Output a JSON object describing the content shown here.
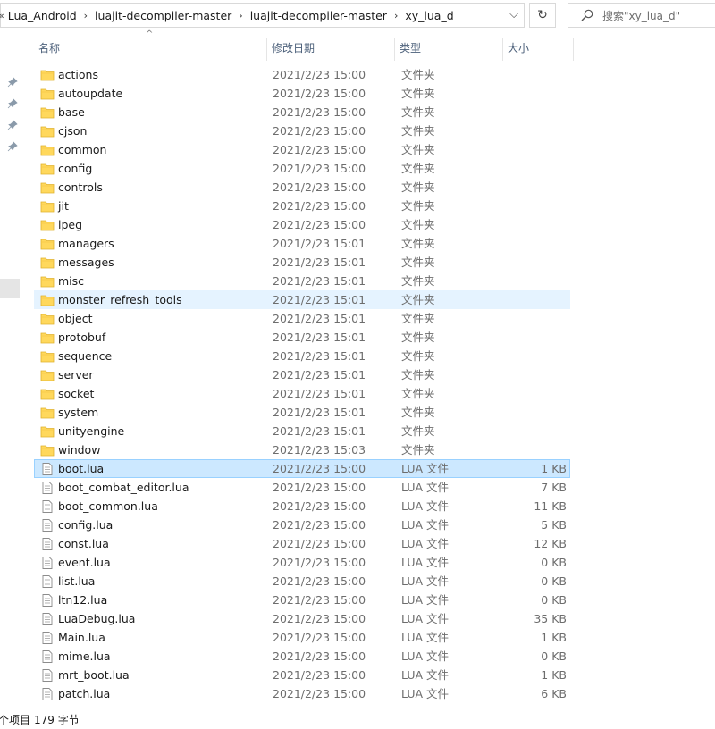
{
  "address_bar": {
    "breadcrumbs": [
      "Lua_Android",
      "luajit-decompiler-master",
      "luajit-decompiler-master",
      "xy_lua_d"
    ]
  },
  "search": {
    "placeholder": "搜索\"xy_lua_d\""
  },
  "columns": {
    "name": "名称",
    "date": "修改日期",
    "type": "类型",
    "size": "大小"
  },
  "items": [
    {
      "name": "actions",
      "date": "2021/2/23 15:00",
      "type": "文件夹",
      "size": "",
      "kind": "folder"
    },
    {
      "name": "autoupdate",
      "date": "2021/2/23 15:00",
      "type": "文件夹",
      "size": "",
      "kind": "folder"
    },
    {
      "name": "base",
      "date": "2021/2/23 15:00",
      "type": "文件夹",
      "size": "",
      "kind": "folder"
    },
    {
      "name": "cjson",
      "date": "2021/2/23 15:00",
      "type": "文件夹",
      "size": "",
      "kind": "folder"
    },
    {
      "name": "common",
      "date": "2021/2/23 15:00",
      "type": "文件夹",
      "size": "",
      "kind": "folder"
    },
    {
      "name": "config",
      "date": "2021/2/23 15:00",
      "type": "文件夹",
      "size": "",
      "kind": "folder"
    },
    {
      "name": "controls",
      "date": "2021/2/23 15:00",
      "type": "文件夹",
      "size": "",
      "kind": "folder"
    },
    {
      "name": "jit",
      "date": "2021/2/23 15:00",
      "type": "文件夹",
      "size": "",
      "kind": "folder"
    },
    {
      "name": "lpeg",
      "date": "2021/2/23 15:00",
      "type": "文件夹",
      "size": "",
      "kind": "folder"
    },
    {
      "name": "managers",
      "date": "2021/2/23 15:01",
      "type": "文件夹",
      "size": "",
      "kind": "folder"
    },
    {
      "name": "messages",
      "date": "2021/2/23 15:01",
      "type": "文件夹",
      "size": "",
      "kind": "folder"
    },
    {
      "name": "misc",
      "date": "2021/2/23 15:01",
      "type": "文件夹",
      "size": "",
      "kind": "folder"
    },
    {
      "name": "monster_refresh_tools",
      "date": "2021/2/23 15:01",
      "type": "文件夹",
      "size": "",
      "kind": "folder",
      "state": "hover"
    },
    {
      "name": "object",
      "date": "2021/2/23 15:01",
      "type": "文件夹",
      "size": "",
      "kind": "folder"
    },
    {
      "name": "protobuf",
      "date": "2021/2/23 15:01",
      "type": "文件夹",
      "size": "",
      "kind": "folder"
    },
    {
      "name": "sequence",
      "date": "2021/2/23 15:01",
      "type": "文件夹",
      "size": "",
      "kind": "folder"
    },
    {
      "name": "server",
      "date": "2021/2/23 15:01",
      "type": "文件夹",
      "size": "",
      "kind": "folder"
    },
    {
      "name": "socket",
      "date": "2021/2/23 15:01",
      "type": "文件夹",
      "size": "",
      "kind": "folder"
    },
    {
      "name": "system",
      "date": "2021/2/23 15:01",
      "type": "文件夹",
      "size": "",
      "kind": "folder"
    },
    {
      "name": "unityengine",
      "date": "2021/2/23 15:01",
      "type": "文件夹",
      "size": "",
      "kind": "folder"
    },
    {
      "name": "window",
      "date": "2021/2/23 15:03",
      "type": "文件夹",
      "size": "",
      "kind": "folder"
    },
    {
      "name": "boot.lua",
      "date": "2021/2/23 15:00",
      "type": "LUA 文件",
      "size": "1 KB",
      "kind": "file",
      "state": "selected"
    },
    {
      "name": "boot_combat_editor.lua",
      "date": "2021/2/23 15:00",
      "type": "LUA 文件",
      "size": "7 KB",
      "kind": "file"
    },
    {
      "name": "boot_common.lua",
      "date": "2021/2/23 15:00",
      "type": "LUA 文件",
      "size": "11 KB",
      "kind": "file"
    },
    {
      "name": "config.lua",
      "date": "2021/2/23 15:00",
      "type": "LUA 文件",
      "size": "5 KB",
      "kind": "file"
    },
    {
      "name": "const.lua",
      "date": "2021/2/23 15:00",
      "type": "LUA 文件",
      "size": "12 KB",
      "kind": "file"
    },
    {
      "name": "event.lua",
      "date": "2021/2/23 15:00",
      "type": "LUA 文件",
      "size": "0 KB",
      "kind": "file"
    },
    {
      "name": "list.lua",
      "date": "2021/2/23 15:00",
      "type": "LUA 文件",
      "size": "0 KB",
      "kind": "file"
    },
    {
      "name": "ltn12.lua",
      "date": "2021/2/23 15:00",
      "type": "LUA 文件",
      "size": "0 KB",
      "kind": "file"
    },
    {
      "name": "LuaDebug.lua",
      "date": "2021/2/23 15:00",
      "type": "LUA 文件",
      "size": "35 KB",
      "kind": "file"
    },
    {
      "name": "Main.lua",
      "date": "2021/2/23 15:00",
      "type": "LUA 文件",
      "size": "1 KB",
      "kind": "file"
    },
    {
      "name": "mime.lua",
      "date": "2021/2/23 15:00",
      "type": "LUA 文件",
      "size": "0 KB",
      "kind": "file"
    },
    {
      "name": "mrt_boot.lua",
      "date": "2021/2/23 15:00",
      "type": "LUA 文件",
      "size": "1 KB",
      "kind": "file"
    },
    {
      "name": "patch.lua",
      "date": "2021/2/23 15:00",
      "type": "LUA 文件",
      "size": "6 KB",
      "kind": "file"
    }
  ],
  "status": {
    "count_suffix": "个项目",
    "size_text": "179 字节"
  },
  "colors": {
    "folder": "#ffd85c",
    "selected_bg": "#cce8ff",
    "hover_bg": "#e5f3ff",
    "header_text": "#4c607a"
  }
}
